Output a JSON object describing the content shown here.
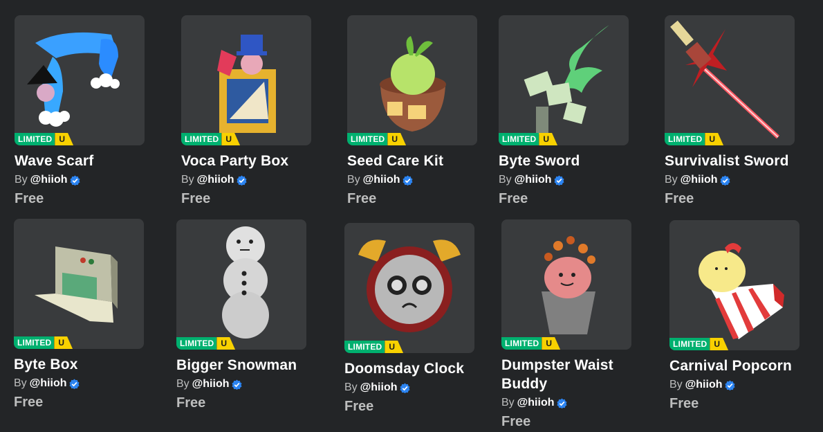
{
  "colors": {
    "background": "#232527",
    "card": "#393b3d",
    "limited_badge": "#00b06f",
    "unique_badge": "#f8d100",
    "verified": "#2c84f1",
    "price_text": "#bdbebe"
  },
  "items": [
    {
      "name": "Wave Scarf",
      "by": "By",
      "creator": "@hiioh",
      "price": "Free",
      "badge_limited": "LIMITED",
      "badge_u": "U"
    },
    {
      "name": "Voca Party Box",
      "by": "By",
      "creator": "@hiioh",
      "price": "Free",
      "badge_limited": "LIMITED",
      "badge_u": "U"
    },
    {
      "name": "Seed Care Kit",
      "by": "By",
      "creator": "@hiioh",
      "price": "Free",
      "badge_limited": "LIMITED",
      "badge_u": "U"
    },
    {
      "name": "Byte Sword",
      "by": "By",
      "creator": "@hiioh",
      "price": "Free",
      "badge_limited": "LIMITED",
      "badge_u": "U"
    },
    {
      "name": "Survivalist Sword",
      "by": "By",
      "creator": "@hiioh",
      "price": "Free",
      "badge_limited": "LIMITED",
      "badge_u": "U"
    },
    {
      "name": "Byte Box",
      "by": "By",
      "creator": "@hiioh",
      "price": "Free",
      "badge_limited": "LIMITED",
      "badge_u": "U"
    },
    {
      "name": "Bigger Snowman",
      "by": "By",
      "creator": "@hiioh",
      "price": "Free",
      "badge_limited": "LIMITED",
      "badge_u": "U"
    },
    {
      "name": "Doomsday Clock",
      "by": "By",
      "creator": "@hiioh",
      "price": "Free",
      "badge_limited": "LIMITED",
      "badge_u": "U"
    },
    {
      "name": "Dumpster Waist Buddy",
      "by": "By",
      "creator": "@hiioh",
      "price": "Free",
      "badge_limited": "LIMITED",
      "badge_u": "U"
    },
    {
      "name": "Carnival Popcorn",
      "by": "By",
      "creator": "@hiioh",
      "price": "Free",
      "badge_limited": "LIMITED",
      "badge_u": "U"
    }
  ]
}
